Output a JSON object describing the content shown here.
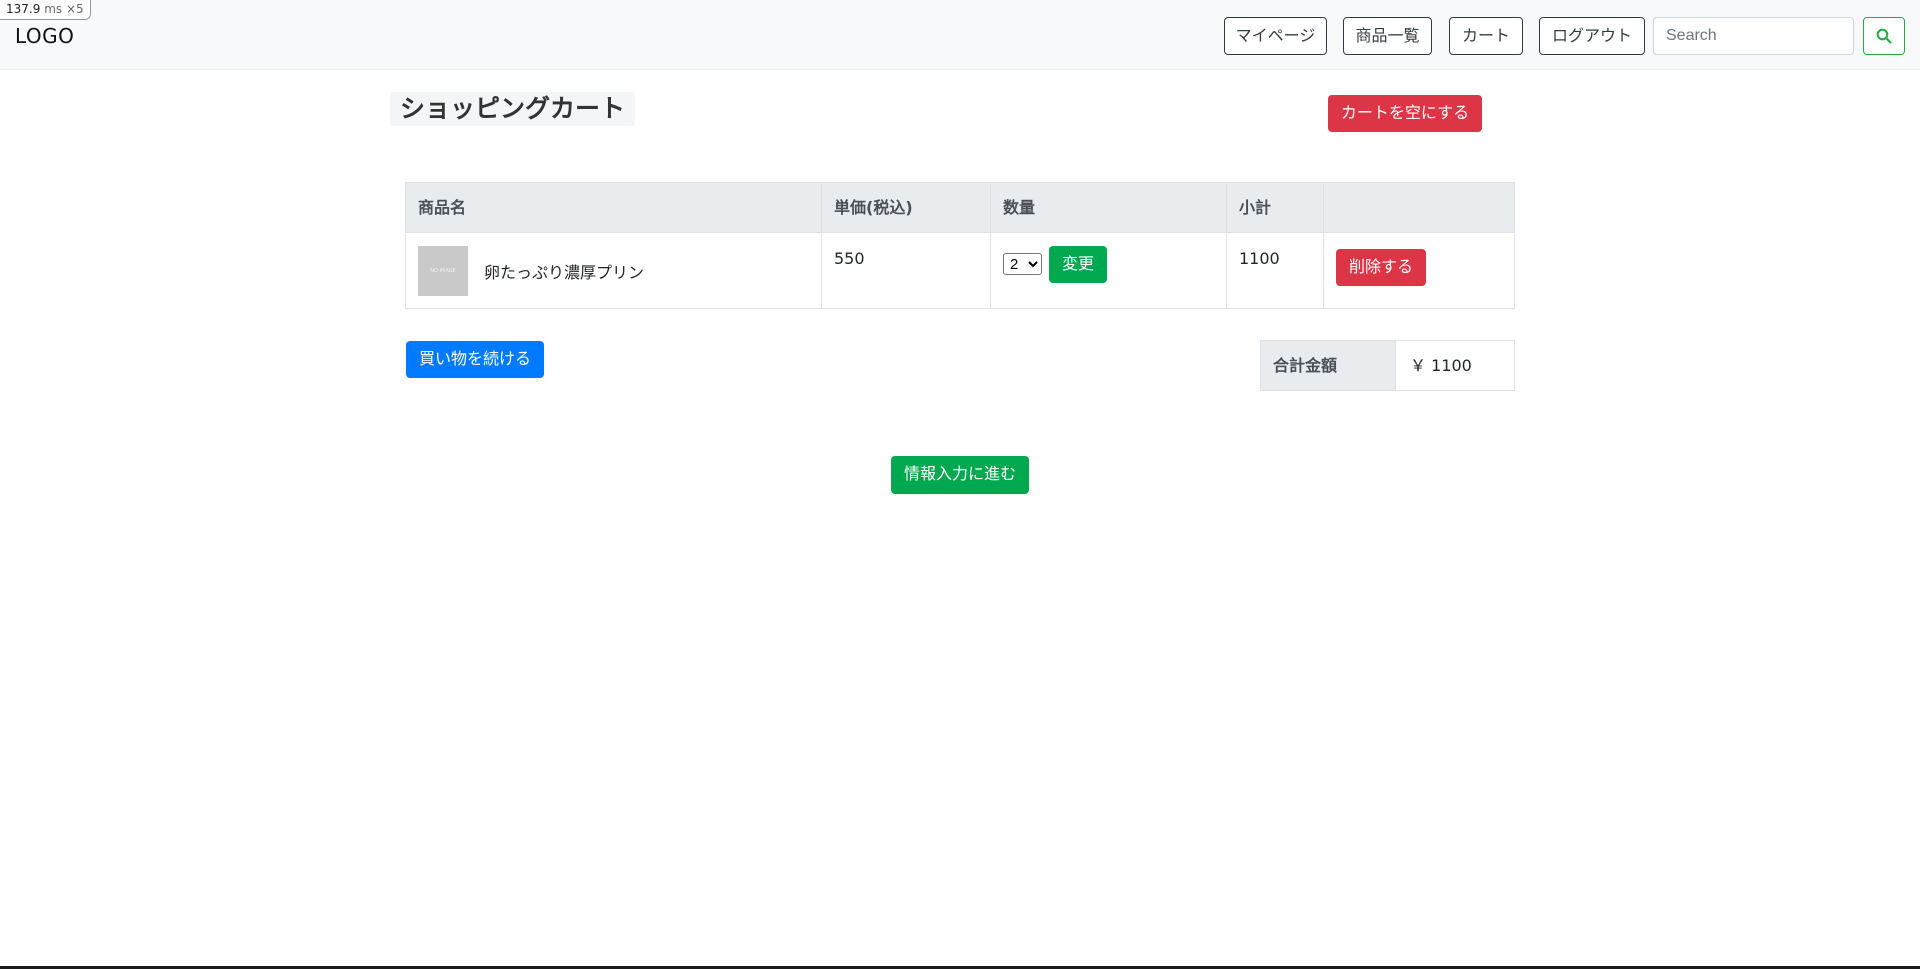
{
  "perf": {
    "value": "137.9",
    "unit": "ms",
    "multiplier": "×5"
  },
  "navbar": {
    "brand": "LOGO",
    "links": [
      "マイページ",
      "商品一覧",
      "カート",
      "ログアウト"
    ],
    "search": {
      "placeholder": "Search",
      "value": ""
    },
    "search_icon": "search-icon"
  },
  "page": {
    "title": "ショッピングカート",
    "empty_cart_label": "カートを空にする"
  },
  "table": {
    "headers": [
      "商品名",
      "単価(税込)",
      "数量",
      "小計",
      ""
    ],
    "rows": [
      {
        "thumbnail_text": "NO IMAGE",
        "name": "卵たっぷり濃厚プリン",
        "price": "550",
        "quantity": "2",
        "change_label": "変更",
        "subtotal": "1100",
        "delete_label": "削除する"
      }
    ]
  },
  "continue_label": "買い物を続ける",
  "total": {
    "label": "合計金額",
    "value": "￥ 1100"
  },
  "proceed_label": "情報入力に進む",
  "colors": {
    "danger": "#dc3545",
    "primary": "#007bff",
    "success": "#00a84f",
    "navbar_bg": "#f8f9fa"
  }
}
